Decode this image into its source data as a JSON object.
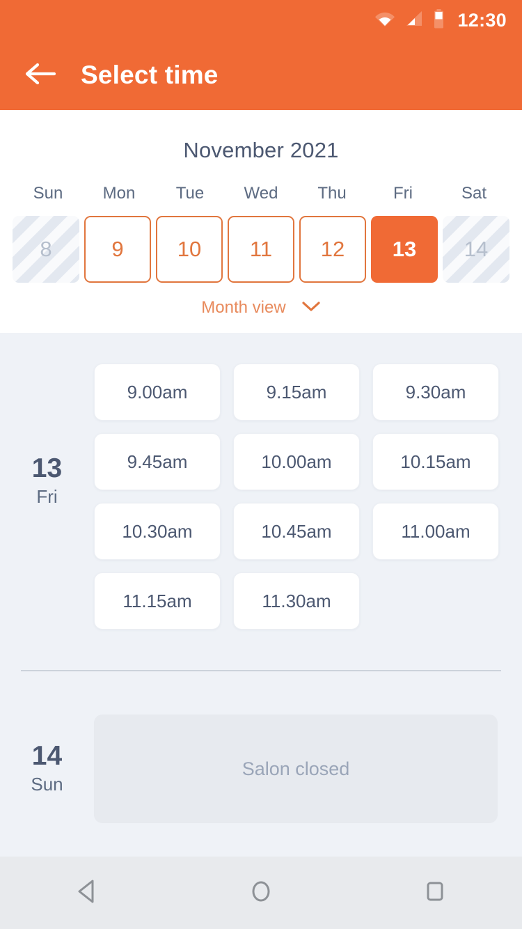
{
  "status_bar": {
    "time": "12:30",
    "icons": [
      "wifi-icon",
      "cellular-signal-icon",
      "battery-icon"
    ]
  },
  "app_bar": {
    "title": "Select time",
    "back_icon": "back-arrow-icon"
  },
  "calendar": {
    "month_label": "November 2021",
    "day_headers": [
      "Sun",
      "Mon",
      "Tue",
      "Wed",
      "Thu",
      "Fri",
      "Sat"
    ],
    "days": [
      {
        "label": "8",
        "state": "disabled"
      },
      {
        "label": "9",
        "state": "available"
      },
      {
        "label": "10",
        "state": "available"
      },
      {
        "label": "11",
        "state": "available"
      },
      {
        "label": "12",
        "state": "available"
      },
      {
        "label": "13",
        "state": "selected"
      },
      {
        "label": "14",
        "state": "disabled"
      }
    ],
    "month_view_label": "Month view",
    "month_view_icon": "chevron-down-icon"
  },
  "schedule": [
    {
      "day_number": "13",
      "day_name": "Fri",
      "slots": [
        "9.00am",
        "9.15am",
        "9.30am",
        "9.45am",
        "10.00am",
        "10.15am",
        "10.30am",
        "10.45am",
        "11.00am",
        "11.15am",
        "11.30am"
      ]
    },
    {
      "day_number": "14",
      "day_name": "Sun",
      "closed_message": "Salon closed"
    }
  ],
  "nav_bar": {
    "buttons": [
      "back-triangle-icon",
      "home-circle-icon",
      "recents-square-icon"
    ]
  },
  "colors": {
    "brand_orange": "#f06a35",
    "accent_orange": "#e1763e",
    "muted_orange": "#e88a5c",
    "text_dark": "#4c5871",
    "text_muted": "#5d6b82",
    "bg_content": "#eff2f7",
    "bg_nav": "#e8eaed",
    "closed_bg": "#e7eaef"
  }
}
